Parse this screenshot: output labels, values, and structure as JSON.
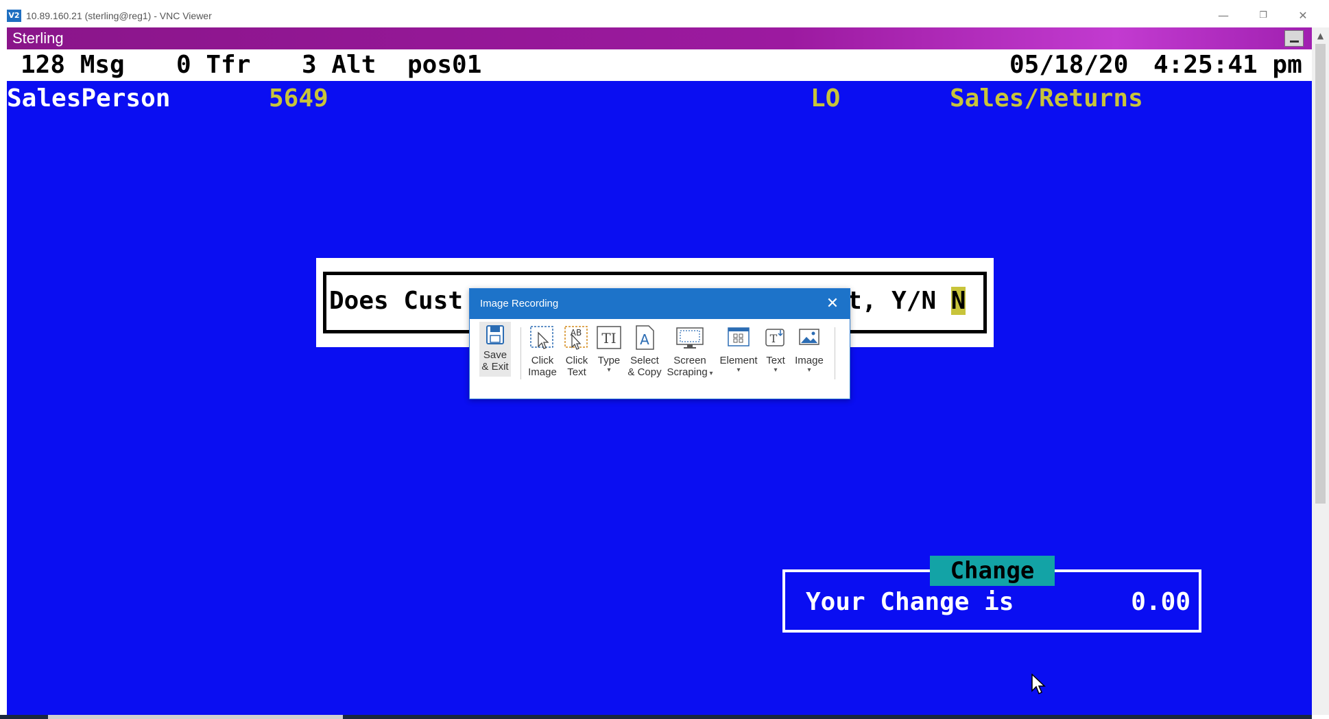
{
  "vnc": {
    "title": "10.89.160.21 (sterling@reg1) - VNC Viewer",
    "logo": "V2"
  },
  "sterling": {
    "title": "Sterling"
  },
  "status": {
    "msg": "128 Msg",
    "tfr": "0 Tfr",
    "alt": "3 Alt",
    "terminal_id": "pos01",
    "date": "05/18/20",
    "time": "4:25:41 pm"
  },
  "header": {
    "salesperson_label": "SalesPerson",
    "salesperson_id": "5649",
    "location": "LO",
    "mode": "Sales/Returns"
  },
  "prompt": {
    "left_text": "Does Cust",
    "right_text": "t, Y/N ",
    "answer": "N"
  },
  "change": {
    "label": "Change",
    "text": "Your Change is",
    "value": "0.00"
  },
  "dialog": {
    "title": "Image Recording",
    "tools": [
      {
        "line1": "Save",
        "line2": "& Exit"
      },
      {
        "line1": "Click",
        "line2": "Image"
      },
      {
        "line1": "Click",
        "line2": "Text"
      },
      {
        "line1": "Type",
        "line2": ""
      },
      {
        "line1": "Select",
        "line2": "& Copy"
      },
      {
        "line1": "Screen",
        "line2": "Scraping"
      },
      {
        "line1": "Element",
        "line2": ""
      },
      {
        "line1": "Text",
        "line2": ""
      },
      {
        "line1": "Image",
        "line2": ""
      }
    ]
  },
  "colors": {
    "terminal_bg": "#0a0ef2",
    "highlight_yellow": "#c8c43a",
    "change_teal": "#13a3a6",
    "title_magenta": "#8a158a",
    "dialog_blue": "#1d73c9"
  }
}
